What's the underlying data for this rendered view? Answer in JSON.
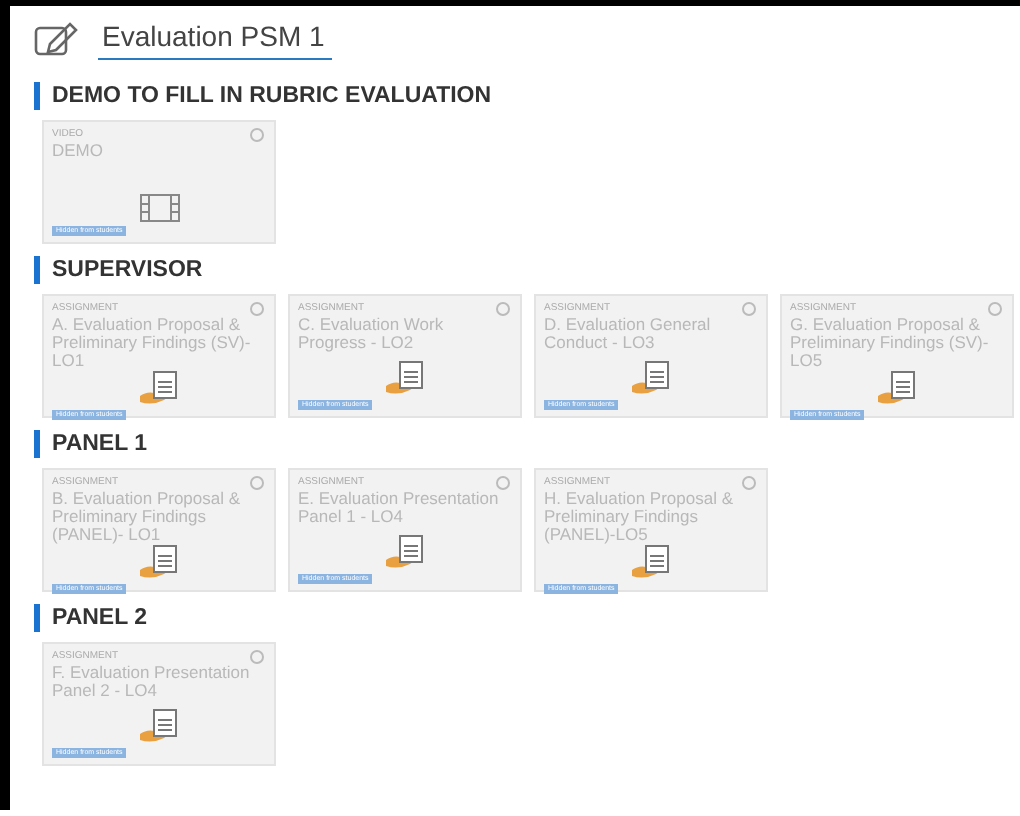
{
  "page": {
    "title": "Evaluation PSM 1"
  },
  "sections": [
    {
      "heading": "DEMO TO FILL IN RUBRIC EVALUATION",
      "items": [
        {
          "kind": "video",
          "type_label": "VIDEO",
          "title": "DEMO",
          "badge": "Hidden from students"
        }
      ]
    },
    {
      "heading": "SUPERVISOR",
      "items": [
        {
          "kind": "assignment",
          "type_label": "ASSIGNMENT",
          "title": "A. Evaluation Proposal & Preliminary Findings (SV)- LO1",
          "badge": "Hidden from students"
        },
        {
          "kind": "assignment",
          "type_label": "ASSIGNMENT",
          "title": "C. Evaluation Work Progress - LO2",
          "badge": "Hidden from students"
        },
        {
          "kind": "assignment",
          "type_label": "ASSIGNMENT",
          "title": "D. Evaluation General Conduct - LO3",
          "badge": "Hidden from students"
        },
        {
          "kind": "assignment",
          "type_label": "ASSIGNMENT",
          "title": "G. Evaluation Proposal & Preliminary Findings (SV)-LO5",
          "badge": "Hidden from students"
        }
      ]
    },
    {
      "heading": "PANEL 1",
      "items": [
        {
          "kind": "assignment",
          "type_label": "ASSIGNMENT",
          "title": "B. Evaluation Proposal & Preliminary Findings (PANEL)- LO1",
          "badge": "Hidden from students"
        },
        {
          "kind": "assignment",
          "type_label": "ASSIGNMENT",
          "title": "E. Evaluation Presentation Panel 1 - LO4",
          "badge": "Hidden from students"
        },
        {
          "kind": "assignment",
          "type_label": "ASSIGNMENT",
          "title": "H. Evaluation Proposal & Preliminary Findings (PANEL)-LO5",
          "badge": "Hidden from students"
        }
      ]
    },
    {
      "heading": "PANEL 2",
      "items": [
        {
          "kind": "assignment",
          "type_label": "ASSIGNMENT",
          "title": "F. Evaluation Presentation Panel 2 - LO4",
          "badge": "Hidden from students"
        }
      ]
    }
  ]
}
